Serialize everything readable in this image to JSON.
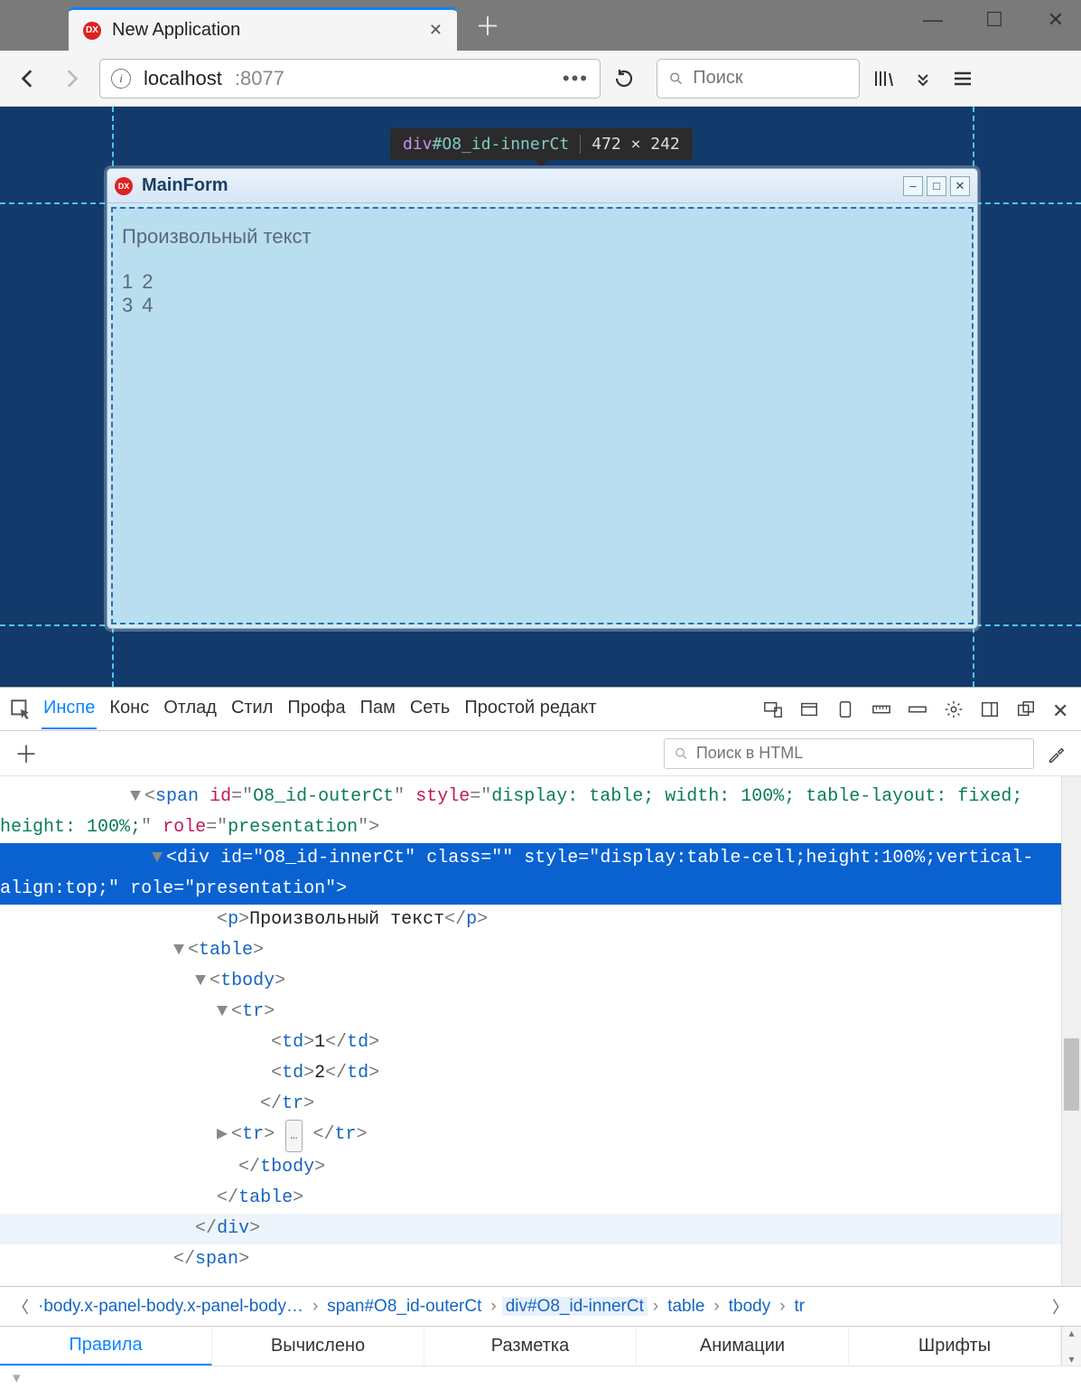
{
  "browser": {
    "tab_title": "New Application",
    "url_host": "localhost",
    "url_port": ":8077",
    "search_placeholder": "Поиск"
  },
  "inspect_tooltip": {
    "selector_tag": "div",
    "selector_id": "#O8_id-innerCt",
    "dimensions": "472 × 242"
  },
  "mainform": {
    "title": "MainForm",
    "text_p": "Произвольный текст",
    "table": [
      [
        "1",
        "2"
      ],
      [
        "3",
        "4"
      ]
    ]
  },
  "devtools": {
    "tabs": [
      "Инспе",
      "Конс",
      "Отлад",
      "Стил",
      "Профа",
      "Пам",
      "Сеть",
      "Простой редакт"
    ],
    "active_tab": 0,
    "html_search_placeholder": "Поиск в HTML",
    "dom": {
      "l0": {
        "indent": 116,
        "twisty": "▼",
        "pre": "<",
        "tag": "span",
        "attrs": [
          [
            "id",
            "O8_id-outerCt"
          ],
          [
            "style",
            "display: table; width: 100%; table-layout: fixed; height: 100%;"
          ],
          [
            "role",
            "presentation"
          ]
        ],
        "post": ">",
        "wrap_indent": 140
      },
      "l1": {
        "indent": 138,
        "twisty": "▼",
        "pre": "<",
        "tag": "div",
        "attrs": [
          [
            "id",
            "O8_id-innerCt"
          ],
          [
            "class",
            ""
          ],
          [
            "style",
            "display:table-cell;height:100%;vertical-align:top;"
          ],
          [
            "role",
            "presentation"
          ]
        ],
        "post": ">",
        "selected": true,
        "wrap_indent": 160
      },
      "l2": {
        "indent": 176,
        "raw_open": "<p>",
        "text": "Произвольный текст",
        "raw_close": "</p>"
      },
      "l3": {
        "indent": 158,
        "twisty": "▼",
        "pre": "<",
        "tag": "table",
        "post": ">"
      },
      "l4": {
        "indent": 178,
        "twisty": "▼",
        "pre": "<",
        "tag": "tbody",
        "post": ">"
      },
      "l5": {
        "indent": 198,
        "twisty": "▼",
        "pre": "<",
        "tag": "tr",
        "post": ">"
      },
      "l6": {
        "indent": 232,
        "raw_open": "<td>",
        "text": "1",
        "raw_close": "</td>"
      },
      "l7": {
        "indent": 232,
        "raw_open": "<td>",
        "text": "2",
        "raw_close": "</td>"
      },
      "l8": {
        "indent": 216,
        "close": "tr"
      },
      "l9": {
        "indent": 198,
        "twisty": "▶",
        "pre": "<",
        "tag": "tr",
        "post": ">",
        "ellipsis": true,
        "close_inline": "tr"
      },
      "l10": {
        "indent": 196,
        "close": "tbody"
      },
      "l11": {
        "indent": 176,
        "close": "table"
      },
      "l12": {
        "indent": 158,
        "close": "div",
        "hovered": true
      },
      "l13": {
        "indent": 138,
        "close": "span"
      }
    },
    "breadcrumbs": [
      "·body.x-panel-body.x-panel-body…",
      "span#O8_id-outerCt",
      "div#O8_id-innerCt",
      "table",
      "tbody",
      "tr"
    ],
    "breadcrumbs_selected": 2,
    "subpanel_tabs": [
      "Правила",
      "Вычислено",
      "Разметка",
      "Анимации",
      "Шрифты"
    ],
    "subpanel_active": 0
  }
}
